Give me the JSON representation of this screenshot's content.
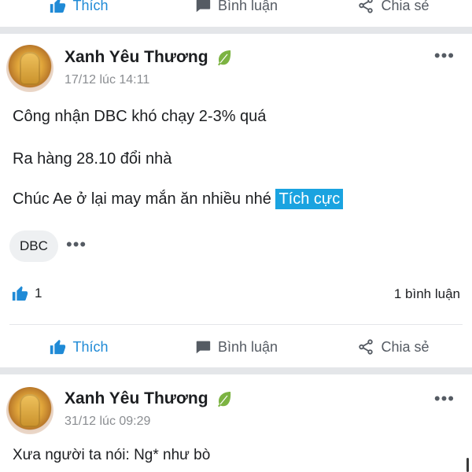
{
  "top_actions": {
    "like": "Thích",
    "comment": "Bình luận",
    "share": "Chia sẻ"
  },
  "post1": {
    "author": "Xanh Yêu Thương",
    "time": "17/12 lúc 14:11",
    "lines": [
      "Công nhận DBC khó chạy 2-3% quá",
      "Ra hàng 28.10 đổi nhà",
      "Chúc Ae ở lại may mắn ăn nhiều nhé"
    ],
    "sentiment_tag": "Tích cực",
    "stock_chip": "DBC",
    "like_count": "1",
    "comment_count": "1 bình luận",
    "actions": {
      "like": "Thích",
      "comment": "Bình luận",
      "share": "Chia sẻ"
    }
  },
  "post2": {
    "author": "Xanh Yêu Thương",
    "time": "31/12 lúc 09:29",
    "line1": "Xưa người ta nói:  Ng* như bò"
  },
  "icons": {
    "like": "thumbs-up-icon",
    "comment": "speech-bubble-icon",
    "share": "share-icon",
    "leaf": "leaf-icon",
    "more": "more-dots-icon"
  },
  "colors": {
    "accent": "#1f8ad6",
    "tag_bg": "#1aa3e0",
    "muted": "#8a8d91"
  }
}
